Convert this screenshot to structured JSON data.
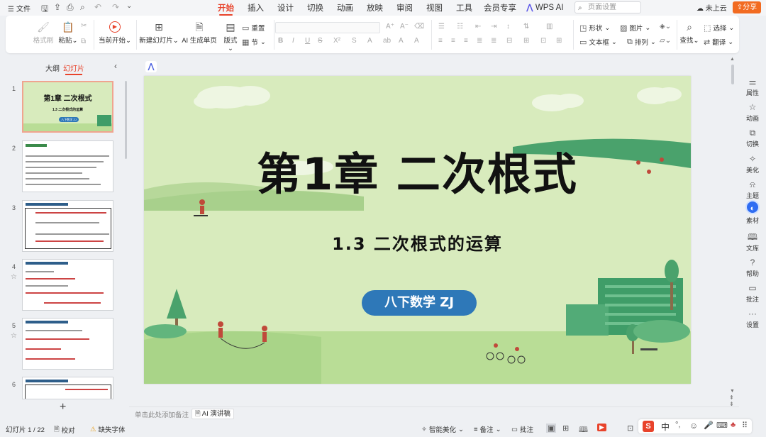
{
  "titlebar": {
    "file_menu": "文件",
    "tabs": [
      "开始",
      "插入",
      "设计",
      "切换",
      "动画",
      "放映",
      "审阅",
      "视图",
      "工具",
      "会员专享",
      "WPS AI"
    ],
    "active_tab": "开始",
    "search_placeholder": "页面设置",
    "cloud": "未上云",
    "share": "分享"
  },
  "ribbon": {
    "format_painter": "格式刷",
    "paste": "粘贴",
    "start_from_current": "当前开始",
    "new_slide": "新建幻灯片",
    "ai_single_page": "AI 生成单页",
    "layout": "版式",
    "reset": "重置",
    "section": "节",
    "shape": "形状",
    "picture": "图片",
    "textbox": "文本框",
    "arrange": "排列",
    "find": "查找",
    "select": "选择",
    "translate": "翻译"
  },
  "leftpanel": {
    "tab_outline": "大纲",
    "tab_slides": "幻灯片",
    "slide_numbers": [
      "1",
      "2",
      "3",
      "4",
      "5",
      "6"
    ],
    "thumb1": {
      "title": "第1章  二次根式",
      "sub": "1.3  二次根式的运算",
      "badge": "八下数学 ZJ"
    },
    "add": "+"
  },
  "slide": {
    "title": "第1章  二次根式",
    "subtitle": "1.3  二次根式的运算",
    "badge": "八下数学  ZJ",
    "colors": {
      "background": "#d8ebbd",
      "badge": "#2e78b8",
      "grass": "#b9dd96",
      "building": "#3f9d68"
    }
  },
  "rightbar": [
    "属性",
    "动画",
    "切换",
    "美化",
    "主题",
    "素材",
    "文库",
    "帮助",
    "批注",
    "设置"
  ],
  "notes": {
    "placeholder": "单击此处添加备注",
    "ai_button": "AI 演讲稿"
  },
  "status": {
    "slide_pos": "幻灯片 1 / 22",
    "proofread": "校对",
    "missing_font": "缺失字体",
    "beautify": "智能美化",
    "notes": "备注",
    "comments": "批注",
    "ime_lang": "中"
  }
}
